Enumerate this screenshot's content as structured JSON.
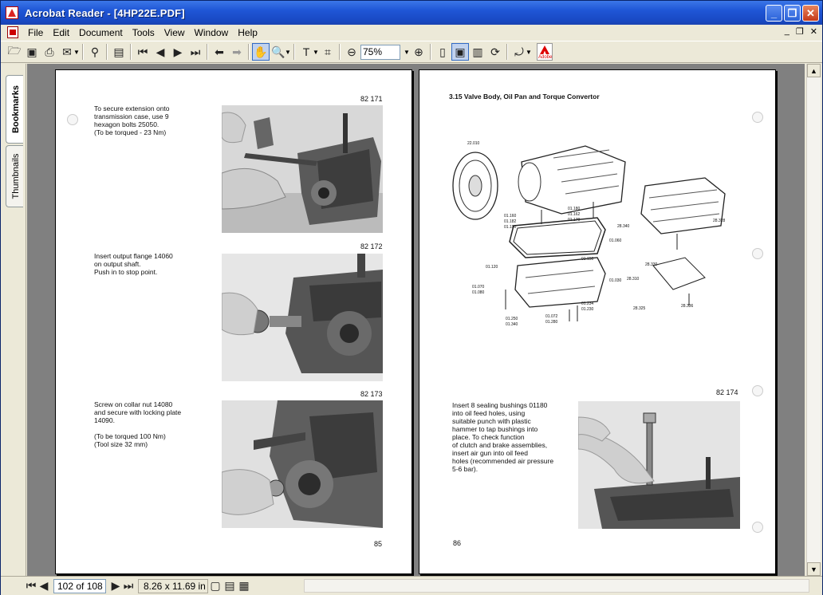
{
  "window": {
    "title": "Acrobat Reader - [4HP22E.PDF]"
  },
  "menu": {
    "items": [
      "File",
      "Edit",
      "Document",
      "Tools",
      "View",
      "Window",
      "Help"
    ]
  },
  "toolbar": {
    "zoom": "75%"
  },
  "sidetabs": {
    "bookmarks": "Bookmarks",
    "thumbnails": "Thumbnails"
  },
  "left_page": {
    "step1": {
      "fig": "82 171",
      "text": "To secure extension onto\ntransmission case, use 9\nhexagon bolts 25050.\n(To be torqued - 23 Nm)"
    },
    "step2": {
      "fig": "82 172",
      "text": "Insert output flange 14060\non output shaft.\nPush in to stop point."
    },
    "step3": {
      "fig": "82 173",
      "text": "Screw on collar nut 14080\nand secure with locking plate\n14090.\n\n(To be torqued 100 Nm)\n(Tool size 32 mm)"
    },
    "page_number": "85"
  },
  "right_page": {
    "heading": "3.15 Valve Body, Oil Pan and Torque Convertor",
    "diagram_labels": [
      "22.010",
      "01.160",
      "01.162",
      "01.170",
      "01.180",
      "01.182",
      "01.190",
      "01.060",
      "01.150",
      "01.120",
      "01.030",
      "01.070",
      "01.080",
      "01.234",
      "01.230",
      "01.250",
      "01.340",
      "01.072",
      "01.280",
      "28.340",
      "28.328",
      "28.330",
      "28.310",
      "28.325",
      "28.336"
    ],
    "step": {
      "fig": "82 174",
      "text": "Insert 8 sealing bushings 01180\ninto oil feed holes, using\nsuitable punch with plastic\nhammer to tap bushings into\nplace. To check function\nof clutch and brake assemblies,\ninsert air gun into oil feed\nholes (recommended air pressure\n5-6 bar)."
    },
    "page_number": "86"
  },
  "statusbar": {
    "page": "102 of 108",
    "size": "8.26 x 11.69 in"
  }
}
